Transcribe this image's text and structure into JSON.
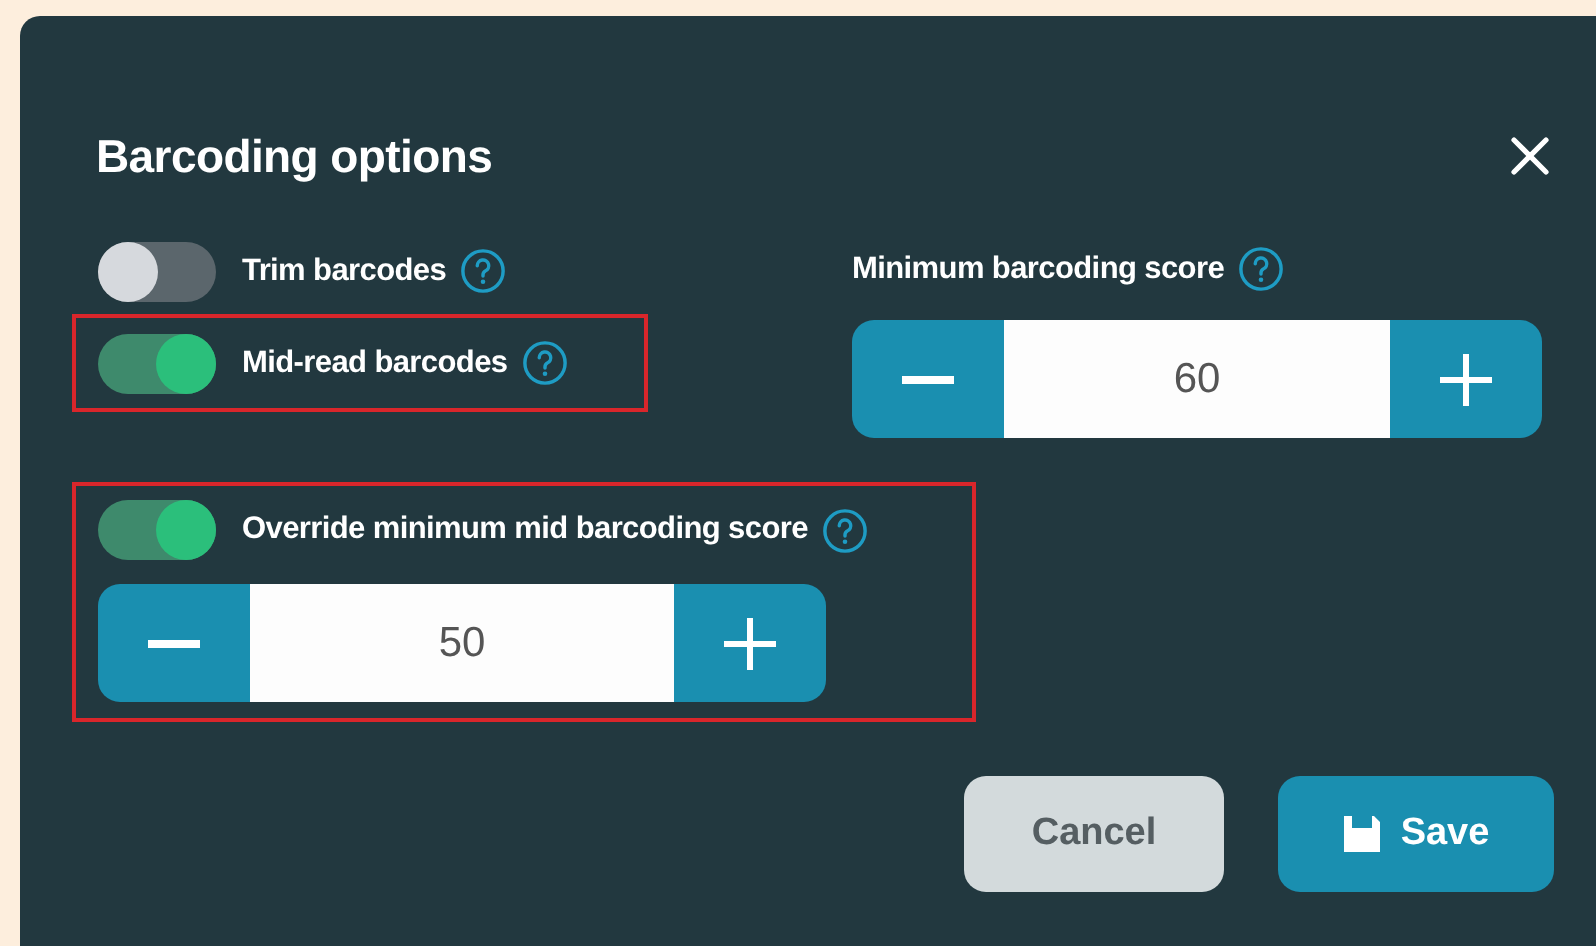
{
  "dialog": {
    "title": "Barcoding options"
  },
  "toggles": [
    {
      "label": "Trim barcodes",
      "on": false,
      "highlighted": false
    },
    {
      "label": "Mid-read barcodes",
      "on": true,
      "highlighted": true
    }
  ],
  "min_score": {
    "label": "Minimum barcoding score",
    "value": "60"
  },
  "override": {
    "label": "Override minimum mid barcoding score",
    "on": true,
    "highlighted": true,
    "value": "50"
  },
  "buttons": [
    {
      "label": "Cancel",
      "kind": "secondary"
    },
    {
      "label": "Save",
      "kind": "primary"
    }
  ]
}
